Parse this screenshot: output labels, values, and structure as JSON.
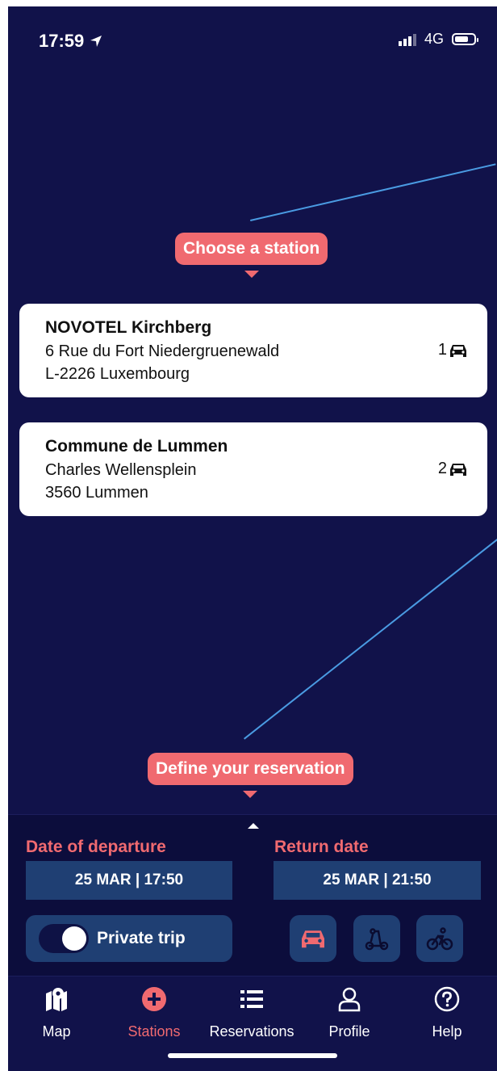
{
  "status_bar": {
    "time": "17:59",
    "network": "4G"
  },
  "tooltips": {
    "choose_station": "Choose a station",
    "define_reservation": "Define your reservation"
  },
  "stations": [
    {
      "name": "NOVOTEL Kirchberg",
      "address_line1": "6 Rue du Fort Niedergruenewald",
      "address_line2": "L-2226 Luxembourg",
      "cars": "1"
    },
    {
      "name": "Commune de Lummen",
      "address_line1": "Charles Wellensplein",
      "address_line2": "3560 Lummen",
      "cars": "2"
    }
  ],
  "reservation": {
    "departure_label": "Date of departure",
    "departure_value": "25 MAR | 17:50",
    "return_label": "Return date",
    "return_value": "25 MAR | 21:50",
    "private_trip_label": "Private trip",
    "vehicle_types": [
      "car-icon",
      "scooter-icon",
      "bicycle-icon"
    ]
  },
  "tabs": [
    {
      "label": "Map",
      "icon": "map-pin-icon"
    },
    {
      "label": "Stations",
      "icon": "plus-circle-icon"
    },
    {
      "label": "Reservations",
      "icon": "list-icon"
    },
    {
      "label": "Profile",
      "icon": "user-icon"
    },
    {
      "label": "Help",
      "icon": "help-icon"
    }
  ],
  "colors": {
    "background": "#11124a",
    "accent": "#f06a70",
    "box": "#1f3f73",
    "annotation_line": "#4a9be2"
  }
}
